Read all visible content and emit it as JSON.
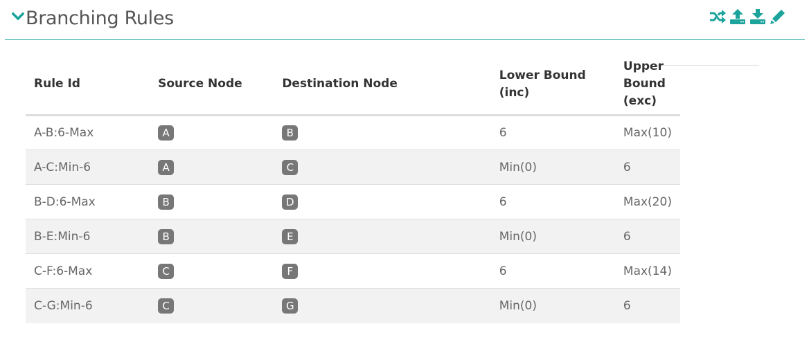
{
  "panel": {
    "title": "Branching Rules",
    "collapse_icon": "chevron-down-icon",
    "toolbar": [
      {
        "name": "shuffle-icon"
      },
      {
        "name": "upload-icon"
      },
      {
        "name": "download-icon"
      },
      {
        "name": "pencil-icon"
      }
    ],
    "accent_color": "#1ba39c",
    "badge_color": "#777777"
  },
  "table": {
    "headers": [
      "Rule Id",
      "Source Node",
      "Destination Node",
      "Lower Bound (inc)",
      "Upper Bound (exc)"
    ],
    "rows": [
      {
        "rule_id": "A-B:6-Max",
        "source": "A",
        "destination": "B",
        "lower": "6",
        "upper": "Max(10)"
      },
      {
        "rule_id": "A-C:Min-6",
        "source": "A",
        "destination": "C",
        "lower": "Min(0)",
        "upper": "6"
      },
      {
        "rule_id": "B-D:6-Max",
        "source": "B",
        "destination": "D",
        "lower": "6",
        "upper": "Max(20)"
      },
      {
        "rule_id": "B-E:Min-6",
        "source": "B",
        "destination": "E",
        "lower": "Min(0)",
        "upper": "6"
      },
      {
        "rule_id": "C-F:6-Max",
        "source": "C",
        "destination": "F",
        "lower": "6",
        "upper": "Max(14)"
      },
      {
        "rule_id": "C-G:Min-6",
        "source": "C",
        "destination": "G",
        "lower": "Min(0)",
        "upper": "6"
      }
    ]
  }
}
